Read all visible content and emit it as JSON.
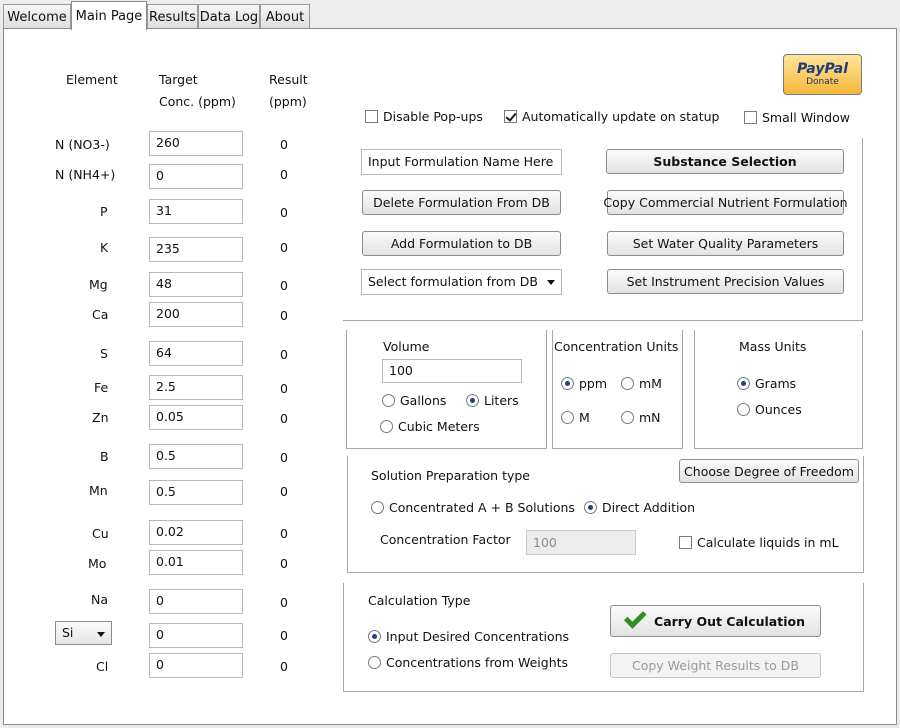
{
  "tabs": [
    "Welcome",
    "Main Page",
    "Results",
    "Data Log",
    "About"
  ],
  "elements_table": {
    "headers": {
      "element": "Element",
      "target_line1": "Target",
      "target_line2": "Conc. (ppm)",
      "result_line1": "Result",
      "result_line2": "(ppm)"
    },
    "rows": [
      {
        "element": "N (NO3-)",
        "target": "260",
        "result": "0"
      },
      {
        "element": "N (NH4+)",
        "target": "0",
        "result": "0"
      },
      {
        "element": "P",
        "target": "31",
        "result": "0"
      },
      {
        "element": "K",
        "target": "235",
        "result": "0"
      },
      {
        "element": "Mg",
        "target": "48",
        "result": "0"
      },
      {
        "element": "Ca",
        "target": "200",
        "result": "0"
      },
      {
        "element": "S",
        "target": "64",
        "result": "0"
      },
      {
        "element": "Fe",
        "target": "2.5",
        "result": "0"
      },
      {
        "element": "Zn",
        "target": "0.05",
        "result": "0"
      },
      {
        "element": "B",
        "target": "0.5",
        "result": "0"
      },
      {
        "element": "Mn",
        "target": "0.5",
        "result": "0"
      },
      {
        "element": "Cu",
        "target": "0.02",
        "result": "0"
      },
      {
        "element": "Mo",
        "target": "0.01",
        "result": "0"
      },
      {
        "element": "Na",
        "target": "0",
        "result": "0"
      },
      {
        "element": "Si",
        "target": "0",
        "result": "0"
      },
      {
        "element": "Cl",
        "target": "0",
        "result": "0"
      }
    ]
  },
  "paypal": {
    "logo": "PayPal",
    "label": "Donate"
  },
  "options": {
    "disable_popups": {
      "label": "Disable Pop-ups",
      "checked": false
    },
    "auto_update": {
      "label": "Automatically update on statup",
      "checked": true
    },
    "small_window": {
      "label": "Small Window",
      "checked": false
    }
  },
  "formulation": {
    "name_input": "Input Formulation Name Here",
    "delete_btn": "Delete Formulation From DB",
    "add_btn": "Add Formulation to DB",
    "select": "Select formulation from DB",
    "substance_btn": "Substance Selection",
    "copy_commercial_btn": "Copy Commercial Nutrient Formulation",
    "water_quality_btn": "Set Water Quality Parameters",
    "instrument_btn": "Set Instrument Precision Values"
  },
  "volume": {
    "title": "Volume",
    "value": "100",
    "gallons": "Gallons",
    "liters": "Liters",
    "cubic_meters": "Cubic Meters",
    "selected": "liters"
  },
  "conc_units": {
    "title": "Concentration Units",
    "ppm": "ppm",
    "mM": "mM",
    "M": "M",
    "mN": "mN",
    "selected": "ppm"
  },
  "mass_units": {
    "title": "Mass Units",
    "grams": "Grams",
    "ounces": "Ounces",
    "selected": "grams"
  },
  "solution": {
    "title": "Solution Preparation type",
    "degree_btn": "Choose Degree of Freedom",
    "concentrated": "Concentrated A + B Solutions",
    "direct": "Direct Addition",
    "selected": "direct",
    "factor_label": "Concentration Factor",
    "factor_value": "100",
    "liquids_label": "Calculate liquids in mL",
    "liquids_checked": false
  },
  "calculation": {
    "title": "Calculation Type",
    "input_desired": "Input Desired Concentrations",
    "from_weights": "Concentrations from  Weights",
    "selected": "input_desired",
    "carry_out_btn": "Carry Out Calculation",
    "copy_weight_btn": "Copy Weight Results to DB"
  }
}
